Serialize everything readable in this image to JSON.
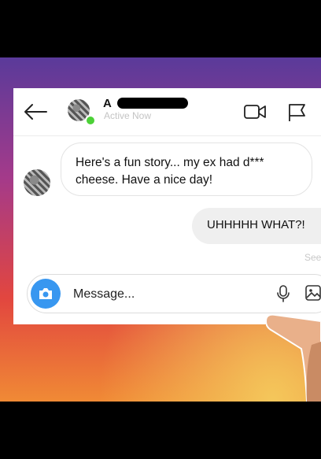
{
  "header": {
    "contact_name": "A",
    "status": "Active Now"
  },
  "messages": {
    "received_line1": "Here's a fun story... my ex had d***",
    "received_line2": "cheese. Have a nice day!",
    "sent": "UHHHHH WHAT?!",
    "seen": "Seen"
  },
  "composer": {
    "placeholder": "Message..."
  },
  "icons": {
    "back": "arrow-left-icon",
    "video": "video-call-icon",
    "flag": "flag-icon",
    "camera": "camera-icon",
    "mic": "microphone-icon",
    "image": "image-icon"
  },
  "colors": {
    "online": "#4cd137",
    "camera_button": "#3897f0",
    "sent_bubble": "#efefef"
  }
}
